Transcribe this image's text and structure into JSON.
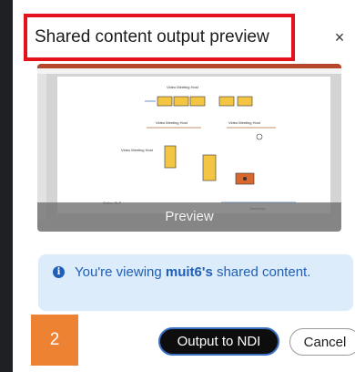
{
  "dialog": {
    "title": "Shared content output preview",
    "close_glyph": "×"
  },
  "preview": {
    "label": "Preview",
    "slide_texts": {
      "line1": "Video Meeting Host",
      "line2": "Video Meeting Host",
      "line3": "Video Meeting Host",
      "line4": "Video Meeting Host",
      "footer": "Online SLP",
      "backdrop": "backdrop"
    }
  },
  "info": {
    "icon": "info-icon",
    "prefix": "You're viewing ",
    "user": "muit6's",
    "suffix": " shared content."
  },
  "badge": {
    "number": "2"
  },
  "buttons": {
    "output_ndi": "Output to NDI",
    "cancel": "Cancel"
  },
  "colors": {
    "title_border": "#e4131b",
    "info_bg": "#dcecfa",
    "info_text": "#1f5fb8",
    "badge_bg": "#ee8233",
    "ndi_border": "#3a6fc4"
  }
}
